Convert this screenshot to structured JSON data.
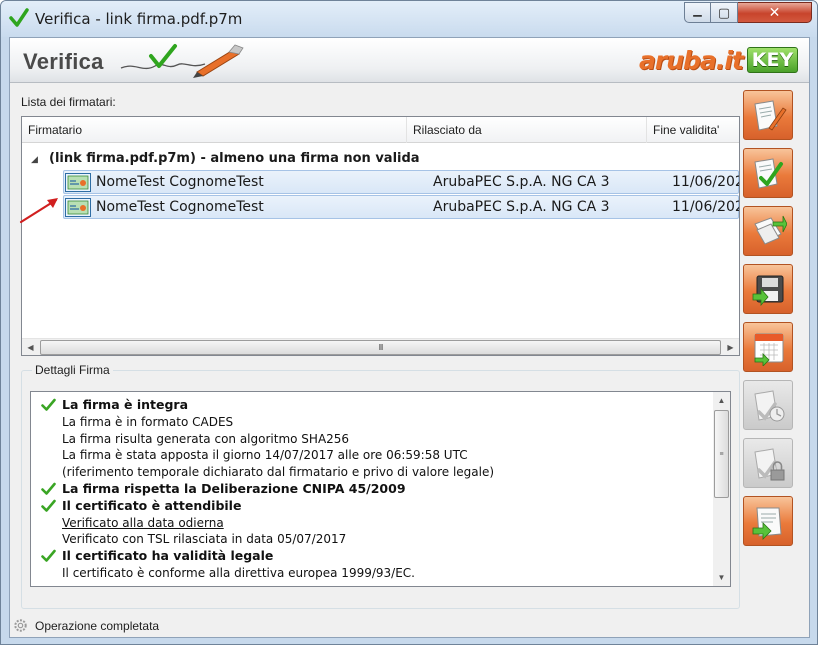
{
  "window": {
    "title": "Verifica - link firma.pdf.p7m",
    "minimize_symbol": "▁",
    "maximize_symbol": "▢",
    "close_symbol": "✕"
  },
  "banner": {
    "title": "Verifica",
    "brand_text": "aruba.it",
    "brand_key": "KEY"
  },
  "signers": {
    "caption": "Lista dei firmatari:",
    "columns": [
      "Firmatario",
      "Rilasciato da",
      "Fine validita'"
    ],
    "group": {
      "expander": "◢",
      "label": "(link firma.pdf.p7m) - almeno una firma non valida"
    },
    "rows": [
      {
        "name": "NomeTest CognomeTest",
        "issuer": "ArubaPEC S.p.A. NG CA 3",
        "end": "11/06/202"
      },
      {
        "name": "NomeTest CognomeTest",
        "issuer": "ArubaPEC S.p.A. NG CA 3",
        "end": "11/06/202"
      }
    ],
    "scroll": {
      "left": "◀",
      "right": "▶",
      "grip": "III"
    }
  },
  "details": {
    "caption": "Dettagli Firma",
    "lines": [
      {
        "text": "La firma è integra",
        "check": true,
        "bold": true
      },
      {
        "text": "La firma è in formato CADES"
      },
      {
        "text": "La firma risulta generata con algoritmo SHA256"
      },
      {
        "text": "La firma è stata apposta il giorno 14/07/2017 alle ore 06:59:58 UTC"
      },
      {
        "text": "(riferimento temporale dichiarato dal firmatario e privo di valore legale)"
      },
      {
        "text": "La firma rispetta la Deliberazione CNIPA 45/2009",
        "check": true,
        "bold": true
      },
      {
        "text": "Il certificato è attendibile",
        "check": true,
        "bold": true
      },
      {
        "text": "Verificato alla data odierna",
        "underline": true
      },
      {
        "text": "Verificato con TSL rilasciata in data 05/07/2017"
      },
      {
        "text": "Il certificato ha validità legale",
        "check": true,
        "bold": true
      },
      {
        "text": "Il certificato è conforme alla direttiva europea 1999/93/EC."
      }
    ],
    "scroll": {
      "up": "▲",
      "down": "▼",
      "grip": "≡"
    }
  },
  "status": {
    "text": "Operazione completata",
    "icon": "gear-icon"
  },
  "toolbar": [
    {
      "name": "sign-document-button",
      "icon": "document-pen-icon",
      "enabled": true
    },
    {
      "name": "verify-signature-button",
      "icon": "document-check-icon",
      "enabled": true
    },
    {
      "name": "open-document-button",
      "icon": "document-arrow-icon",
      "enabled": true
    },
    {
      "name": "save-button",
      "icon": "floppy-disk-icon",
      "enabled": true
    },
    {
      "name": "timestamp-button",
      "icon": "calendar-icon",
      "enabled": true
    },
    {
      "name": "verify-timestamp-button",
      "icon": "document-clock-icon",
      "enabled": false
    },
    {
      "name": "encrypt-button",
      "icon": "document-lock-icon",
      "enabled": false
    },
    {
      "name": "extract-document-button",
      "icon": "document-extract-icon",
      "enabled": true
    }
  ],
  "colors": {
    "accent_orange": "#ea7a3b",
    "selection_blue": "#d9e7f7",
    "check_green": "#3aa524",
    "arrow_red": "#d11f1f",
    "brand_green": "#4aa12a"
  }
}
